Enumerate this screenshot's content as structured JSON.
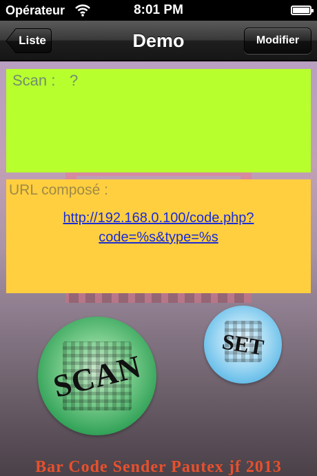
{
  "status_bar": {
    "carrier": "Opérateur",
    "time": "8:01 PM",
    "wifi_icon": "wifi-icon",
    "battery_icon": "battery-icon"
  },
  "nav_bar": {
    "title": "Demo",
    "back_label": "Liste",
    "edit_label": "Modifier"
  },
  "scan_panel": {
    "label": "Scan :",
    "value": "?",
    "color": "#b8ff2e"
  },
  "url_panel": {
    "label": "URL composé :",
    "link_line1": "http://192.168.0.100/code.php?",
    "link_line2": "code=%s&type=%s",
    "color": "#ffcf40"
  },
  "buttons": {
    "scan_label": "SCAN",
    "set_label": "SET"
  },
  "footer": {
    "text": "Bar Code Sender Pautex jf 2013"
  }
}
